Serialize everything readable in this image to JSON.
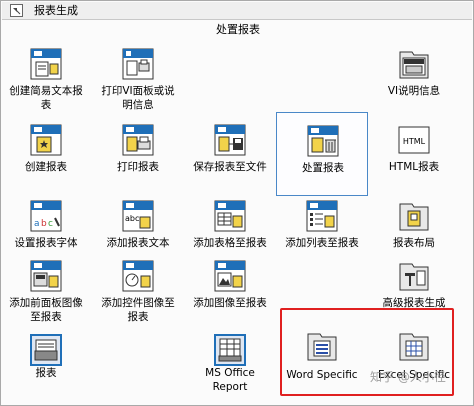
{
  "window": {
    "title": "报表生成",
    "caption": "处置报表"
  },
  "icons": [
    {
      "name": "create-simple-text-report-icon",
      "label": "创建简易文本报\n表"
    },
    {
      "name": "print-vi-panel-or-docs-icon",
      "label": "打印VI面板或说\n明信息"
    },
    {
      "name": "vi-documentation-icon",
      "label": "VI说明信息"
    },
    {
      "name": "new-report-icon",
      "label": "创建报表"
    },
    {
      "name": "print-report-icon",
      "label": "打印报表"
    },
    {
      "name": "save-report-to-file-icon",
      "label": "保存报表至文件"
    },
    {
      "name": "dispose-report-icon",
      "label": "处置报表"
    },
    {
      "name": "html-report-icon",
      "label": "HTML报表"
    },
    {
      "name": "set-report-font-icon",
      "label": "设置报表字体"
    },
    {
      "name": "append-report-text-icon",
      "label": "添加报表文本"
    },
    {
      "name": "append-table-to-report-icon",
      "label": "添加表格至报表"
    },
    {
      "name": "append-list-to-report-icon",
      "label": "添加列表至报表"
    },
    {
      "name": "report-layout-icon",
      "label": "报表布局"
    },
    {
      "name": "append-front-panel-image-icon",
      "label": "添加前面板图像\n至报表"
    },
    {
      "name": "append-control-image-icon",
      "label": "添加控件图像至\n报表"
    },
    {
      "name": "append-image-to-report-icon",
      "label": "添加图像至报表"
    },
    {
      "name": "advanced-report-generation-icon",
      "label": "高级报表生成"
    },
    {
      "name": "report-express-vi-icon",
      "label": "报表"
    },
    {
      "name": "ms-office-report-icon",
      "label": "MS Office\nReport"
    },
    {
      "name": "word-specific-icon",
      "label": "Word Specific"
    },
    {
      "name": "excel-specific-icon",
      "label": "Excel Specific"
    }
  ],
  "watermark": "知乎 @人小径",
  "colors": {
    "selection": "#4a88c8",
    "highlight": "#e02020",
    "vi_header": "#1f6fb8"
  }
}
